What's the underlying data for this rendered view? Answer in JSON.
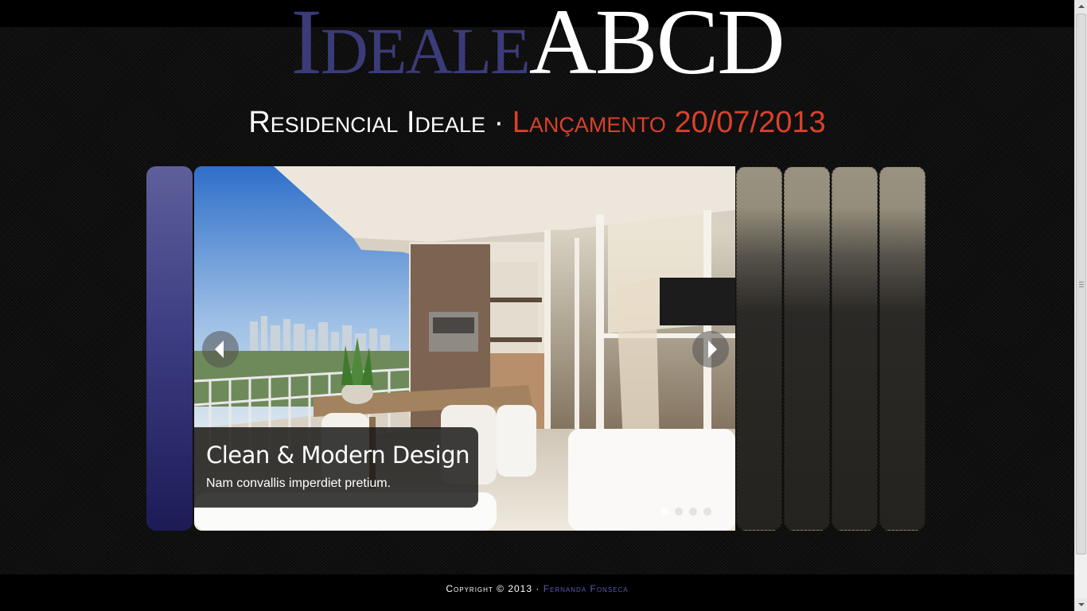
{
  "header": {
    "logo_part1": "Ideale",
    "logo_part2": "ABCD",
    "subtitle_part1": "Residencial Ideale · ",
    "subtitle_part2": "Lançamento 20/07/2013"
  },
  "slider": {
    "caption_title": "Clean & Modern Design",
    "caption_text": "Nam convallis imperdiet pretium.",
    "slide_count": 4,
    "active_slide": 1,
    "prev_icon": "chevron-left-icon",
    "next_icon": "chevron-right-icon"
  },
  "footer": {
    "copyright": "Copyright © 2013 · ",
    "author": "Fernanda Fonseca"
  },
  "colors": {
    "logo_primary": "#3b3b7a",
    "accent_red": "#d9412a",
    "footer_link": "#5a5ab0",
    "panel_blue": "#3d3d83"
  }
}
